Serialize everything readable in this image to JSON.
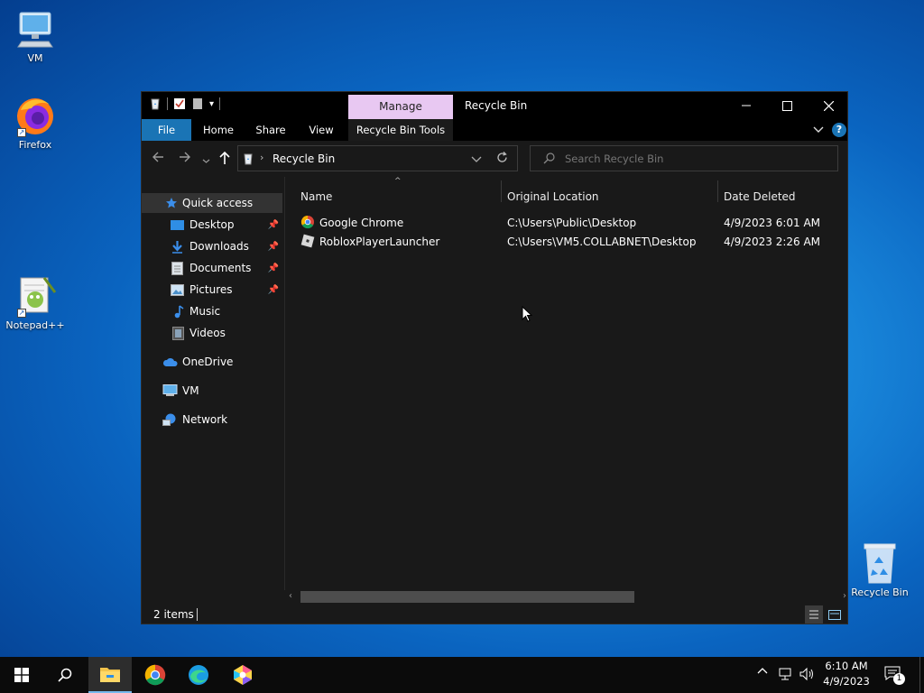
{
  "desktop": {
    "icons": [
      {
        "label": "VM"
      },
      {
        "label": "Firefox"
      },
      {
        "label": "Notepad++"
      },
      {
        "label": "Recycle Bin"
      }
    ]
  },
  "window": {
    "title": "Recycle Bin",
    "manage_tab": "Manage",
    "ribbon_tabs": [
      "File",
      "Home",
      "Share",
      "View",
      "Recycle Bin Tools"
    ],
    "address": {
      "path": "Recycle Bin"
    },
    "search": {
      "placeholder": "Search Recycle Bin"
    },
    "nav": {
      "quick_access": "Quick access",
      "items": [
        "Desktop",
        "Downloads",
        "Documents",
        "Pictures",
        "Music",
        "Videos"
      ],
      "onedrive": "OneDrive",
      "vm": "VM",
      "network": "Network"
    },
    "columns": [
      "Name",
      "Original Location",
      "Date Deleted"
    ],
    "rows": [
      {
        "name": "Google Chrome",
        "location": "C:\\Users\\Public\\Desktop",
        "date": "4/9/2023 6:01 AM"
      },
      {
        "name": "RobloxPlayerLauncher",
        "location": "C:\\Users\\VM5.COLLABNET\\Desktop",
        "date": "4/9/2023 2:26 AM"
      }
    ],
    "status": {
      "items": "2 items"
    }
  },
  "taskbar": {
    "time": "6:10 AM",
    "date": "4/9/2023",
    "notification_count": "1"
  },
  "colors": {
    "accent": "#1a74b5",
    "manage_tab": "#e8c8f2",
    "window_bg": "#191919",
    "taskbar_bg": "#0b0b0b"
  }
}
